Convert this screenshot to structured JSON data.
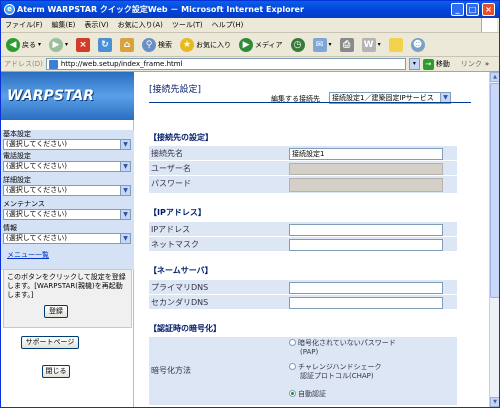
{
  "window": {
    "title": "Aterm WARPSTAR クイック設定Web － Microsoft Internet Explorer"
  },
  "menubar": {
    "items": [
      "ファイル(F)",
      "編集(E)",
      "表示(V)",
      "お気に入り(A)",
      "ツール(T)",
      "ヘルプ(H)"
    ]
  },
  "toolbar": {
    "back_label": "戻る",
    "search_label": "検索",
    "favorites_label": "お気に入り",
    "media_label": "メディア"
  },
  "addressbar": {
    "label": "アドレス(D)",
    "url": "http://web.setup/index_frame.html",
    "go_label": "移動",
    "links_label": "リンク"
  },
  "left": {
    "logo": "WARPSTAR",
    "nav": [
      {
        "label": "基本設定",
        "value": "(選択してください)"
      },
      {
        "label": "電話設定",
        "value": "(選択してください)"
      },
      {
        "label": "詳細設定",
        "value": "(選択してください)"
      },
      {
        "label": "メンテナンス",
        "value": "(選択してください)"
      },
      {
        "label": "情報",
        "value": "(選択してください)"
      }
    ],
    "menu_list": "メニュー一覧",
    "note": "このボタンをクリックして設定を登録します。[WARPSTAR(親機)を再起動します。]",
    "register_button": "登録",
    "support_button": "サポートページ",
    "close_button": "閉じる"
  },
  "right": {
    "heading": "[接続先設定]",
    "edit_label": "編集する接続先",
    "edit_value": "接続設定1／建築固定IPサービス",
    "sec_connection": "【接続先の設定】",
    "conn_name_label": "接続先名",
    "conn_name_value": "接続設定1",
    "user_label": "ユーザー名",
    "password_label": "パスワード",
    "sec_ip": "【IPアドレス】",
    "ip_label": "IPアドレス",
    "netmask_label": "ネットマスク",
    "sec_dns": "【ネームサーバ】",
    "primary_dns_label": "プライマリDNS",
    "secondary_dns_label": "セカンダリDNS",
    "sec_auth": "【認証時の暗号化】",
    "enc_label": "暗号化方法",
    "enc_opt1": "暗号化されていないパスワード",
    "enc_opt1b": "(PAP)",
    "enc_opt2": "チャレンジハンドシェーク",
    "enc_opt2b": "認証プロトコル(CHAP)",
    "enc_opt3": "自動認証"
  }
}
